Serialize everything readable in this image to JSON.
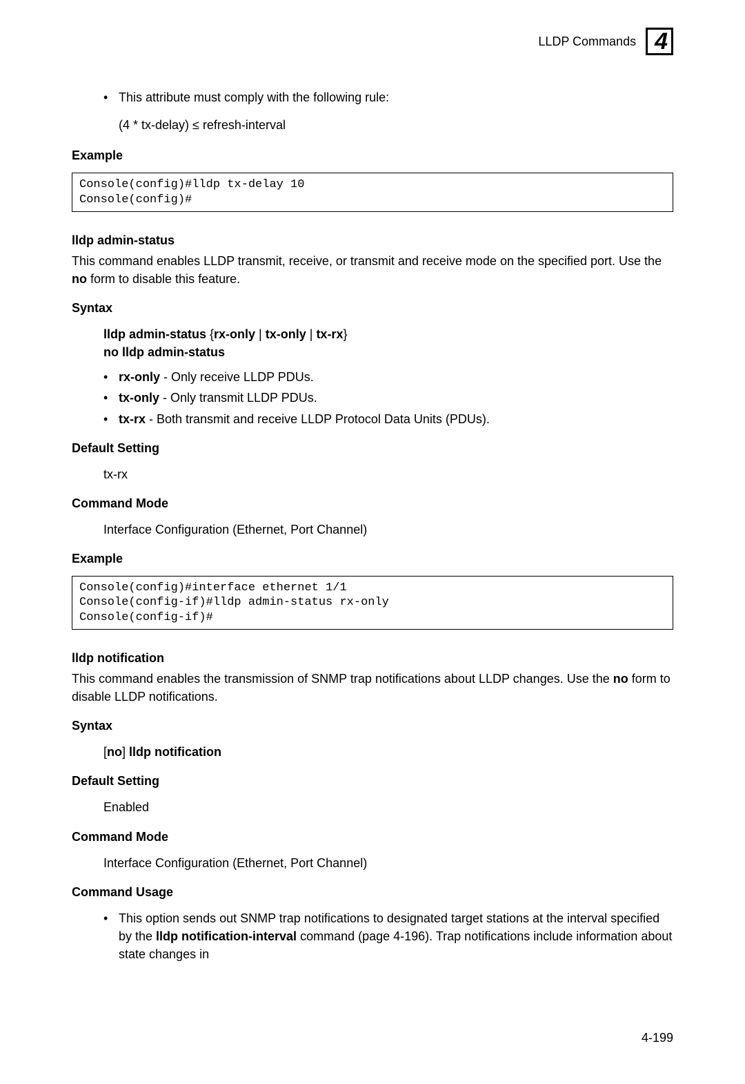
{
  "header": {
    "section_title": "LLDP Commands",
    "chapter_num": "4"
  },
  "top_bullets": {
    "b1": "This attribute must comply with the following rule:",
    "b1_sub": "(4 * tx-delay) ≤ refresh-interval"
  },
  "section1": {
    "example_label": "Example",
    "code": "Console(config)#lldp tx-delay 10\nConsole(config)#"
  },
  "cmd1": {
    "title": "lldp admin-status",
    "desc_a": "This command enables LLDP transmit, receive, or transmit and receive mode on the specified port. Use the ",
    "desc_bold": "no",
    "desc_b": " form to disable this feature.",
    "syntax_label": "Syntax",
    "syntax1_a": "lldp admin-status",
    "syntax1_b": " {",
    "syntax1_c": "rx-only",
    "syntax1_d": " | ",
    "syntax1_e": "tx-only",
    "syntax1_f": " | ",
    "syntax1_g": "tx-rx",
    "syntax1_h": "}",
    "syntax2": "no lldp admin-status",
    "opt1_b": "rx-only",
    "opt1_t": " - Only receive LLDP PDUs.",
    "opt2_b": "tx-only",
    "opt2_t": " - Only transmit LLDP PDUs.",
    "opt3_b": "tx-rx",
    "opt3_t": " - Both transmit and receive LLDP Protocol Data Units (PDUs).",
    "default_label": "Default Setting",
    "default_val": "tx-rx",
    "mode_label": "Command Mode",
    "mode_val": "Interface Configuration (Ethernet, Port Channel)",
    "example_label": "Example",
    "code": "Console(config)#interface ethernet 1/1\nConsole(config-if)#lldp admin-status rx-only\nConsole(config-if)#"
  },
  "cmd2": {
    "title": "lldp notification",
    "desc_a": "This command enables the transmission of SNMP trap notifications about LLDP changes. Use the ",
    "desc_bold": "no",
    "desc_b": " form to disable LLDP notifications.",
    "syntax_label": "Syntax",
    "syntax_a": "[",
    "syntax_b": "no",
    "syntax_c": "] ",
    "syntax_d": "lldp notification",
    "default_label": "Default Setting",
    "default_val": "Enabled",
    "mode_label": "Command Mode",
    "mode_val": "Interface Configuration (Ethernet, Port Channel)",
    "usage_label": "Command Usage",
    "usage_a": "This option sends out SNMP trap notifications to designated target stations at the interval specified by the ",
    "usage_b": "lldp notification-interval",
    "usage_c": " command (page 4-196). Trap notifications include information about state changes in"
  },
  "page_num": "4-199"
}
